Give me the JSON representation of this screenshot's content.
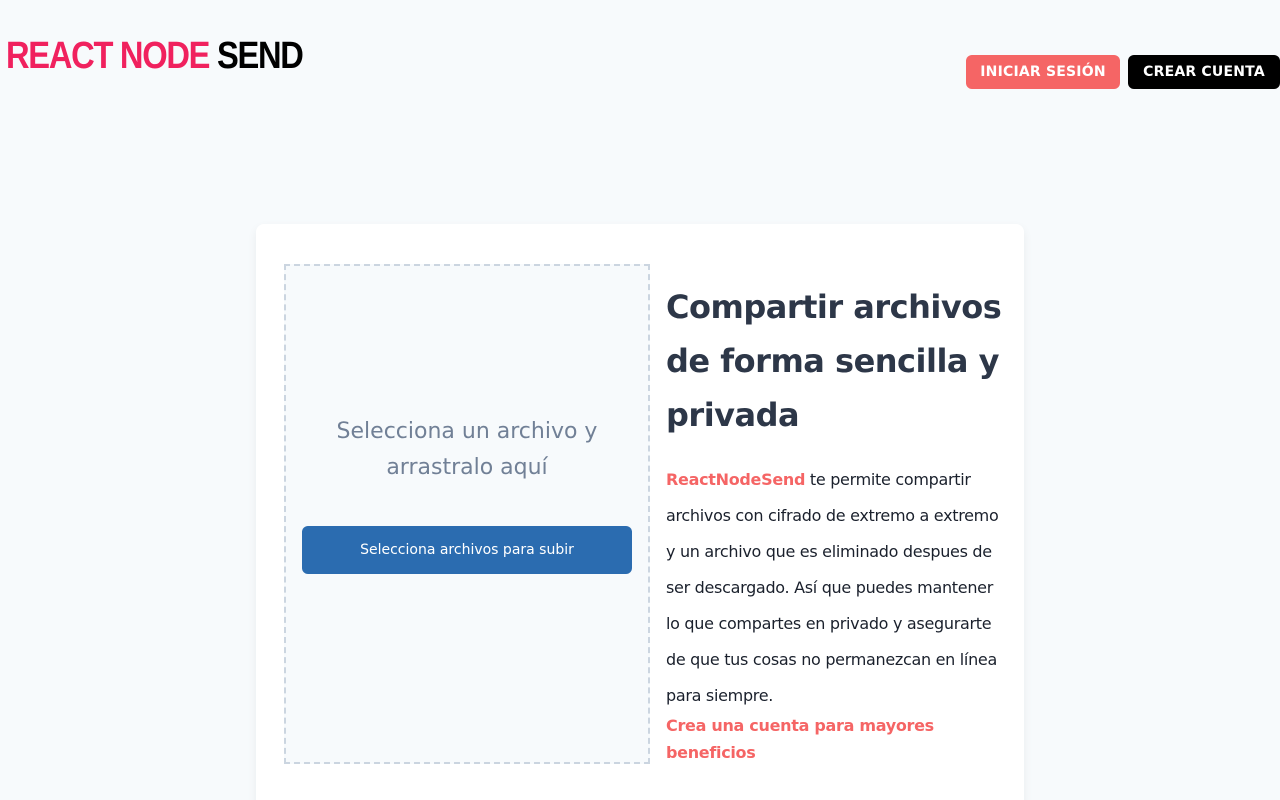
{
  "header": {
    "logo_part1": "REACT NODE",
    "logo_part2": "SEND",
    "login_label": "INICIAR SESIÓN",
    "register_label": "CREAR CUENTA"
  },
  "upload": {
    "prompt": "Selecciona un archivo y arrastralo aquí",
    "button_label": "Selecciona archivos para subir"
  },
  "info": {
    "title": "Compartir archivos de forma sencilla y privada",
    "brand": "ReactNodeSend",
    "description": " te permite compartir archivos con cifrado de extremo a extremo y un archivo que es eliminado despues de ser descargado. Así que puedes mantener lo que compartes en privado y asegurarte de que tus cosas no permanezcan en línea para siempre.",
    "cta": "Crea una cuenta para mayores beneficios"
  },
  "colors": {
    "brand_pink": "#f0215e",
    "accent_red": "#f56565",
    "primary_blue": "#2b6cb0",
    "page_bg": "#f7fafc"
  }
}
